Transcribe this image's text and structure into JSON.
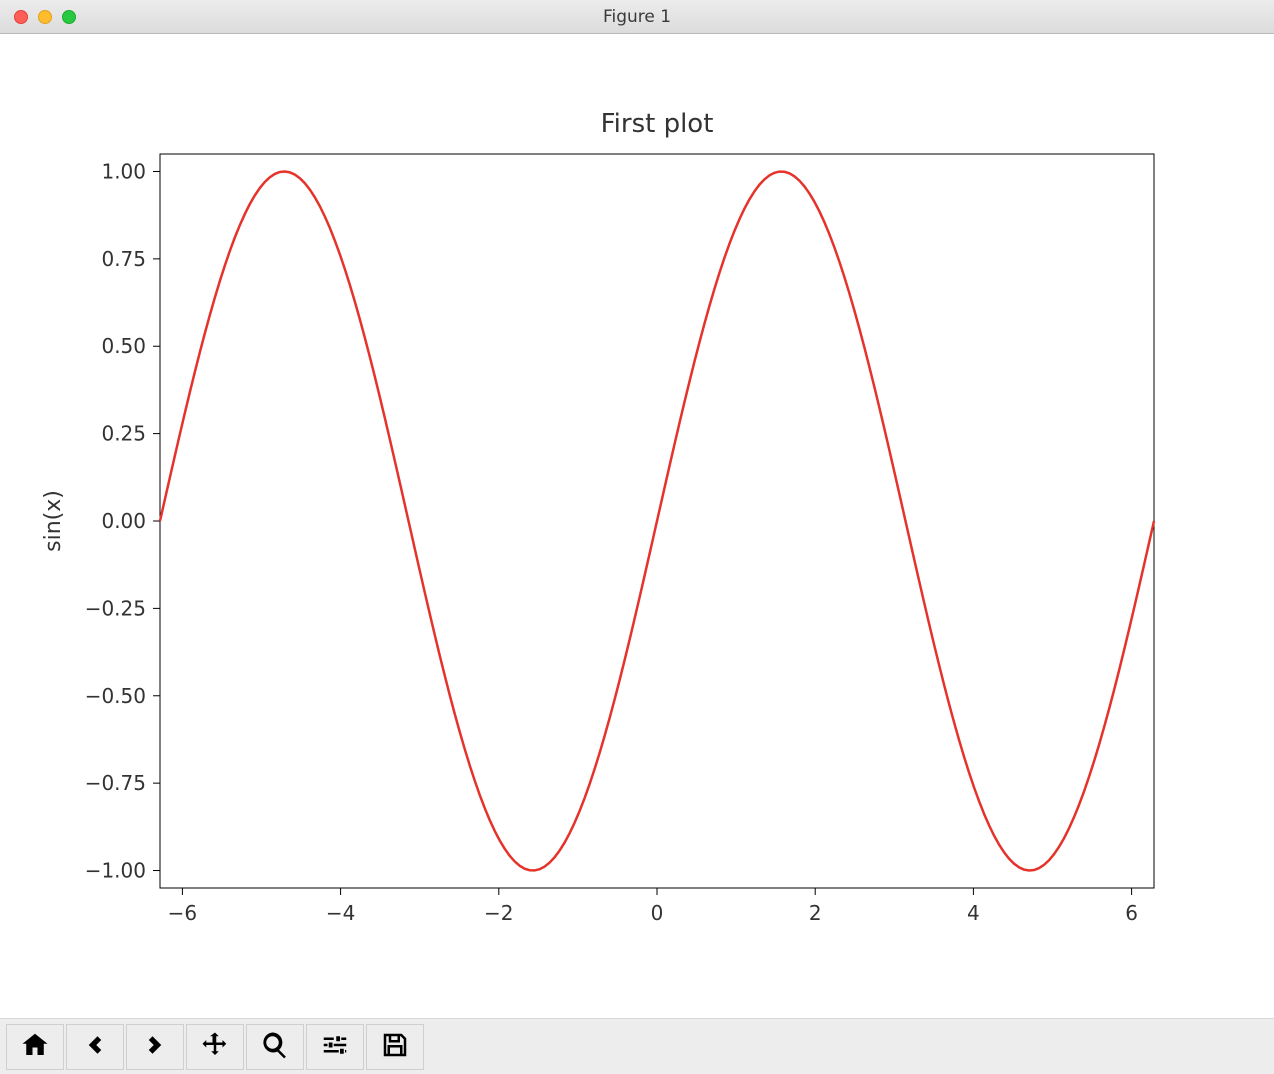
{
  "window": {
    "title": "Figure 1"
  },
  "toolbar": {
    "buttons": [
      {
        "name": "home-button",
        "icon": "home-icon"
      },
      {
        "name": "back-button",
        "icon": "arrow-left-icon"
      },
      {
        "name": "forward-button",
        "icon": "arrow-right-icon"
      },
      {
        "name": "pan-button",
        "icon": "move-icon"
      },
      {
        "name": "zoom-button",
        "icon": "magnify-icon"
      },
      {
        "name": "configure-button",
        "icon": "sliders-icon"
      },
      {
        "name": "save-button",
        "icon": "save-icon"
      }
    ]
  },
  "chart_data": {
    "type": "line",
    "title": "First plot",
    "xlabel": "",
    "ylabel": "sin(x)",
    "xlim": [
      -6.283185307,
      6.283185307
    ],
    "ylim": [
      -1.05,
      1.05
    ],
    "x_ticks": [
      -6,
      -4,
      -2,
      0,
      2,
      4,
      6
    ],
    "y_ticks": [
      -1.0,
      -0.75,
      -0.5,
      -0.25,
      0.0,
      0.25,
      0.5,
      0.75,
      1.0
    ],
    "x_tick_labels": [
      "−6",
      "−4",
      "−2",
      "0",
      "2",
      "4",
      "6"
    ],
    "y_tick_labels": [
      "−1.00",
      "−0.75",
      "−0.50",
      "−0.25",
      "0.00",
      "0.25",
      "0.50",
      "0.75",
      "1.00"
    ],
    "series": [
      {
        "name": "sin(x)",
        "color": "#e5332b",
        "function": "sin",
        "x_range": [
          -6.283185307,
          6.283185307
        ],
        "n_points": 200
      }
    ]
  }
}
